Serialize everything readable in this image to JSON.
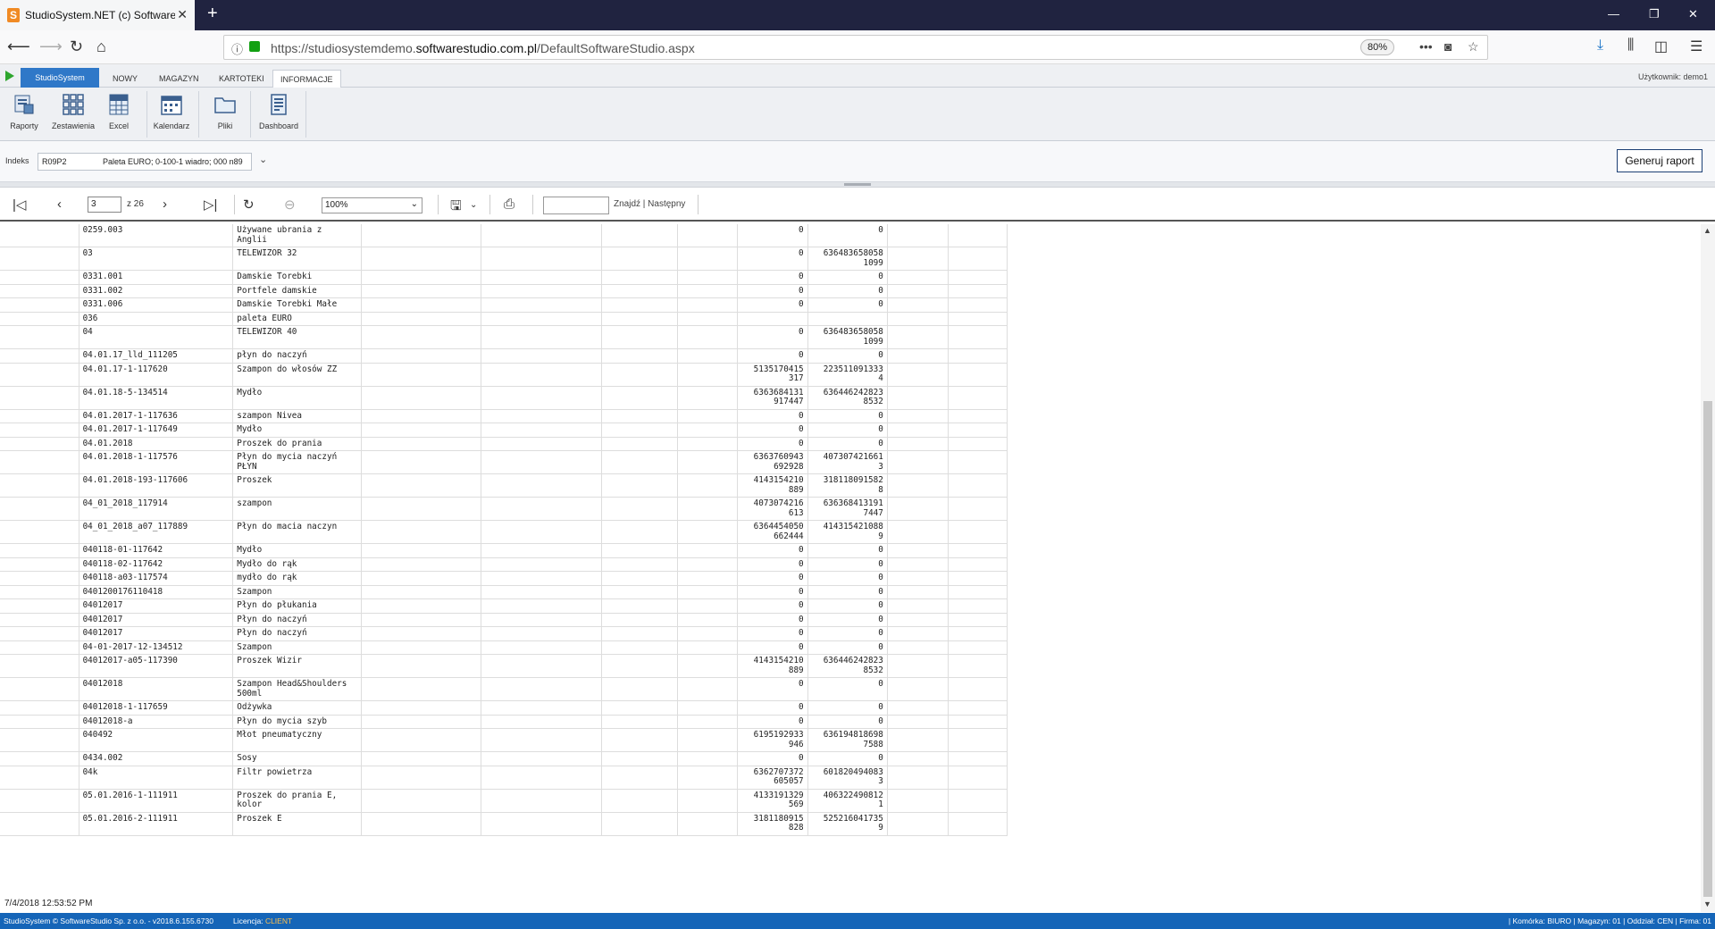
{
  "browser": {
    "tab_title": "StudioSystem.NET (c) Software",
    "url_prefix": "https://studiosystemdemo.",
    "url_domain": "softwarestudio.com.pl",
    "url_path": "/DefaultSoftwareStudio.aspx",
    "zoom": "80%"
  },
  "menu": {
    "brand": "StudioSystem",
    "items": [
      "NOWY",
      "MAGAZYN",
      "KARTOTEKI",
      "INFORMACJE"
    ],
    "active": "INFORMACJE",
    "user": "Użytkownik: demo1"
  },
  "ribbon": {
    "buttons": [
      "Raporty",
      "Zestawienia",
      "Excel",
      "Kalendarz",
      "Pliki",
      "Dashboard"
    ]
  },
  "filter": {
    "label": "Indeks",
    "code": "R09P2",
    "description": "Paleta EURO; 0-100-1 wiadro; 000 n89",
    "generate": "Generuj raport"
  },
  "report_toolbar": {
    "page": "3",
    "of": "z 26",
    "zoom": "100%",
    "find_label": "Znajdź | Następny"
  },
  "rows": [
    {
      "code": "0259.003",
      "name": "Używane ubrania z Anglii",
      "v1": "0",
      "v2": "0"
    },
    {
      "code": "03",
      "name": "TELEWIZOR 32",
      "v1": "0",
      "v2": "636483658058\n1099"
    },
    {
      "code": "0331.001",
      "name": "Damskie Torebki",
      "v1": "0",
      "v2": "0"
    },
    {
      "code": "0331.002",
      "name": "Portfele damskie",
      "v1": "0",
      "v2": "0"
    },
    {
      "code": "0331.006",
      "name": "Damskie Torebki Małe",
      "v1": "0",
      "v2": "0"
    },
    {
      "code": "036",
      "name": "paleta EURO",
      "v1": "",
      "v2": ""
    },
    {
      "code": "04",
      "name": "TELEWIZOR 40",
      "v1": "0",
      "v2": "636483658058\n1099"
    },
    {
      "code": "04.01.17_lld_111205",
      "name": "płyn do naczyń",
      "v1": "0",
      "v2": "0"
    },
    {
      "code": "04.01.17-1-117620",
      "name": "Szampon do włosów ZZ",
      "v1": "5135170415\n317",
      "v2": "223511091333\n4"
    },
    {
      "code": "04.01.18-5-134514",
      "name": "Mydło",
      "v1": "6363684131\n917447",
      "v2": "636446242823\n8532"
    },
    {
      "code": "04.01.2017-1-117636",
      "name": "szampon Nivea",
      "v1": "0",
      "v2": "0"
    },
    {
      "code": "04.01.2017-1-117649",
      "name": "Mydło",
      "v1": "0",
      "v2": "0"
    },
    {
      "code": "04.01.2018",
      "name": "Proszek do prania",
      "v1": "0",
      "v2": "0"
    },
    {
      "code": "04.01.2018-1-117576",
      "name": "Płyn do mycia naczyń PŁYN",
      "v1": "6363760943\n692928",
      "v2": "407307421661\n3"
    },
    {
      "code": "04.01.2018-193-117606",
      "name": "Proszek",
      "v1": "4143154210\n889",
      "v2": "318118091582\n8"
    },
    {
      "code": "04_01_2018_117914",
      "name": "szampon",
      "v1": "4073074216\n613",
      "v2": "636368413191\n7447"
    },
    {
      "code": "04_01_2018_a07_117889",
      "name": "Płyn do macia naczyn",
      "v1": "6364454050\n662444",
      "v2": "414315421088\n9"
    },
    {
      "code": "040118-01-117642",
      "name": "Mydło",
      "v1": "0",
      "v2": "0"
    },
    {
      "code": "040118-02-117642",
      "name": "Mydło do rąk",
      "v1": "0",
      "v2": "0"
    },
    {
      "code": "040118-a03-117574",
      "name": "mydło do rąk",
      "v1": "0",
      "v2": "0"
    },
    {
      "code": "0401200176110418",
      "name": "Szampon",
      "v1": "0",
      "v2": "0"
    },
    {
      "code": "04012017",
      "name": "Płyn do płukania",
      "v1": "0",
      "v2": "0"
    },
    {
      "code": "04012017",
      "name": "Płyn do naczyń",
      "v1": "0",
      "v2": "0"
    },
    {
      "code": "04012017",
      "name": "Płyn do naczyń",
      "v1": "0",
      "v2": "0"
    },
    {
      "code": "04-01-2017-12-134512",
      "name": "Szampon",
      "v1": "0",
      "v2": "0"
    },
    {
      "code": "04012017-a05-117390",
      "name": "Proszek Wizir",
      "v1": "4143154210\n889",
      "v2": "636446242823\n8532"
    },
    {
      "code": "04012018",
      "name": "Szampon Head&Shoulders\n500ml",
      "v1": "0",
      "v2": "0"
    },
    {
      "code": "04012018-1-117659",
      "name": "Odżywka",
      "v1": "0",
      "v2": "0"
    },
    {
      "code": "04012018-a",
      "name": "Płyn do mycia szyb",
      "v1": "0",
      "v2": "0"
    },
    {
      "code": "040492",
      "name": "Młot pneumatyczny",
      "v1": "6195192933\n946",
      "v2": "636194818698\n7588"
    },
    {
      "code": "0434.002",
      "name": "Sosy",
      "v1": "0",
      "v2": "0"
    },
    {
      "code": "04k",
      "name": "Filtr powietrza",
      "v1": "6362707372\n605057",
      "v2": "601820494083\n3"
    },
    {
      "code": "05.01.2016-1-111911",
      "name": "Proszek do prania E, kolor",
      "v1": "4133191329\n569",
      "v2": "406322490812\n1"
    },
    {
      "code": "05.01.2016-2-111911",
      "name": "Proszek E",
      "v1": "3181180915\n828",
      "v2": "525216041735\n9"
    }
  ],
  "timestamp": "7/4/2018 12:53:52 PM",
  "status": {
    "left": "StudioSystem © SoftwareStudio Sp. z o.o. - v2018.6.155.6730",
    "license_label": "Licencja:",
    "license_value": "CLIENT",
    "right": "| Komórka: BIURO | Magazyn: 01 | Oddział: CEN | Firma: 01"
  }
}
